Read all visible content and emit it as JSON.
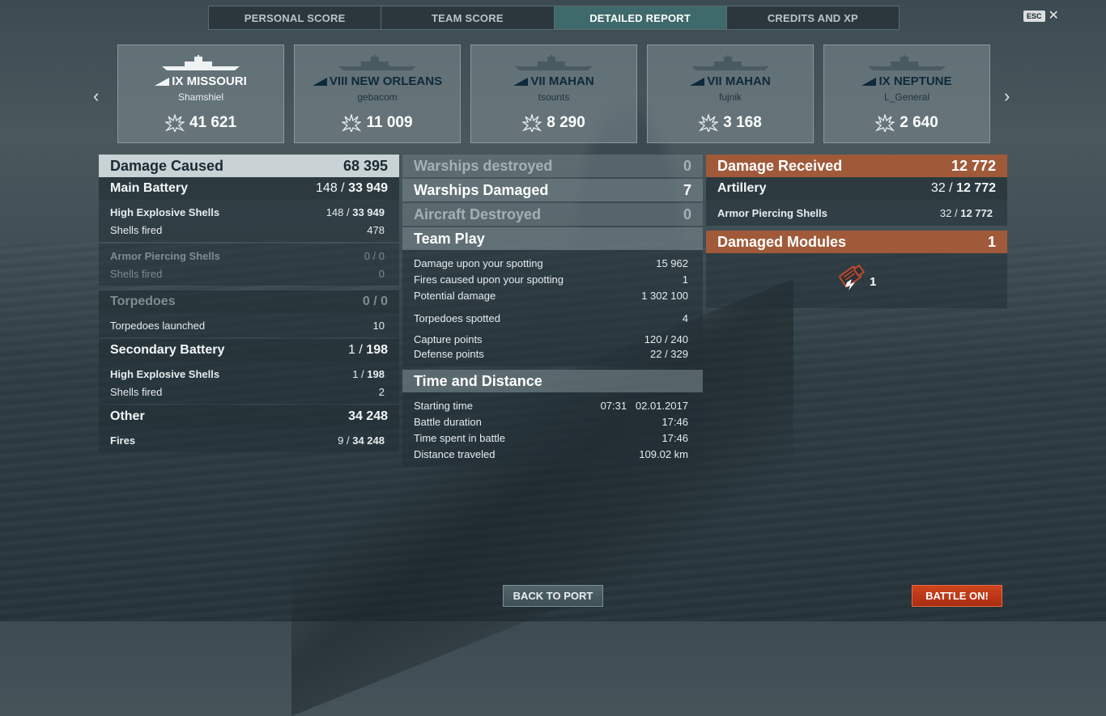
{
  "tabs": [
    "PERSONAL SCORE",
    "TEAM SCORE",
    "DETAILED REPORT",
    "CREDITS AND XP"
  ],
  "esc": {
    "key": "ESC",
    "close": "✕"
  },
  "nav": {
    "prev": "‹",
    "next": "›"
  },
  "ships": [
    {
      "name": "IX MISSOURI",
      "player": "Shamshiel",
      "damage": "41 621"
    },
    {
      "name": "VIII NEW ORLEANS",
      "player": "gebacom",
      "damage": "11 009"
    },
    {
      "name": "VII MAHAN",
      "player": "tsounts",
      "damage": "8 290"
    },
    {
      "name": "VII MAHAN",
      "player": "fujnik",
      "damage": "3 168"
    },
    {
      "name": "IX NEPTUNE",
      "player": "L_General",
      "damage": "2 640"
    }
  ],
  "left": {
    "damage_caused": {
      "label": "Damage Caused",
      "value": "68 395"
    },
    "main_battery": {
      "label": "Main Battery",
      "a": "148 /",
      "b": "33 949"
    },
    "mb_he": {
      "label": "High Explosive Shells",
      "a": "148 /",
      "b": "33 949"
    },
    "mb_he_fired": {
      "label": "Shells fired",
      "value": "478"
    },
    "mb_ap": {
      "label": "Armor Piercing Shells",
      "value": "0 / 0"
    },
    "mb_ap_fired": {
      "label": "Shells fired",
      "value": "0"
    },
    "torpedoes": {
      "label": "Torpedoes",
      "value": "0 / 0"
    },
    "torp_launched": {
      "label": "Torpedoes launched",
      "value": "10"
    },
    "secondary": {
      "label": "Secondary Battery",
      "a": "1 /",
      "b": "198"
    },
    "sec_he": {
      "label": "High Explosive Shells",
      "a": "1 /",
      "b": "198"
    },
    "sec_fired": {
      "label": "Shells fired",
      "value": "2"
    },
    "other": {
      "label": "Other",
      "value": "34 248"
    },
    "fires": {
      "label": "Fires",
      "a": "9 /",
      "b": "34 248"
    }
  },
  "middle": {
    "warships_destroyed": {
      "label": "Warships destroyed",
      "value": "0"
    },
    "warships_damaged": {
      "label": "Warships Damaged",
      "value": "7"
    },
    "aircraft_destroyed": {
      "label": "Aircraft Destroyed",
      "value": "0"
    },
    "team_play": {
      "label": "Team Play"
    },
    "tp_rows": [
      {
        "label": "Damage upon your spotting",
        "value": "15 962"
      },
      {
        "label": "Fires caused upon your spotting",
        "value": "1"
      },
      {
        "label": "Potential damage",
        "value": "1 302 100"
      },
      {
        "label": "Torpedoes spotted",
        "value": "4"
      },
      {
        "label": "Capture points",
        "value": "120 / 240"
      },
      {
        "label": "Defense points",
        "value": "22 / 329"
      }
    ],
    "time_distance": {
      "label": "Time and Distance"
    },
    "td_rows": [
      {
        "label": "Starting time",
        "value": "07:31   02.01.2017"
      },
      {
        "label": "Battle duration",
        "value": "17:46"
      },
      {
        "label": "Time spent in battle",
        "value": "17:46"
      },
      {
        "label": "Distance traveled",
        "value": "109.02 km"
      }
    ]
  },
  "right": {
    "damage_received": {
      "label": "Damage Received",
      "value": "12 772"
    },
    "artillery": {
      "label": "Artillery",
      "a": "32 /",
      "b": "12 772"
    },
    "ap_shells": {
      "label": "Armor Piercing Shells",
      "a": "32 /",
      "b": "12 772"
    },
    "damaged_modules": {
      "label": "Damaged Modules",
      "value": "1"
    },
    "module_count": "1"
  },
  "buttons": {
    "back": "BACK TO PORT",
    "battle": "BATTLE ON!"
  },
  "colors": {
    "accent_orange": "#a05a3a",
    "tab_active": "#3f6a6b",
    "battle_btn": "#c93c1a"
  }
}
